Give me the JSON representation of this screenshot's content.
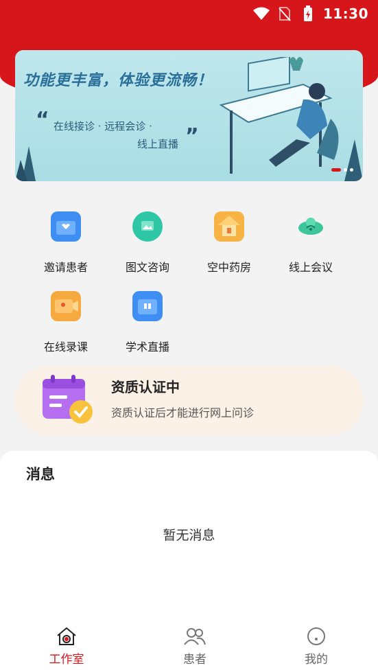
{
  "status": {
    "time": "11:30"
  },
  "banner": {
    "title": "功能更丰富，体验更流畅！",
    "line1": "在线接诊 · 远程会诊 ·",
    "line2": "线上直播"
  },
  "grid": [
    {
      "label": "邀请患者",
      "icon": "invite-patient-icon",
      "color": "#3f8ef4"
    },
    {
      "label": "图文咨询",
      "icon": "image-consult-icon",
      "color": "#2fc6a6"
    },
    {
      "label": "空中药房",
      "icon": "pharmacy-icon",
      "color": "#f7b445"
    },
    {
      "label": "线上会议",
      "icon": "meeting-icon",
      "color": "#3cc69a"
    },
    {
      "label": "在线录课",
      "icon": "record-course-icon",
      "color": "#f5a93f"
    },
    {
      "label": "学术直播",
      "icon": "live-tv-icon",
      "color": "#3f8ef4"
    }
  ],
  "certification": {
    "title": "资质认证中",
    "subtitle": "资质认证后才能进行网上问诊"
  },
  "messages": {
    "title": "消息",
    "empty": "暂无消息"
  },
  "tabs": [
    {
      "label": "工作室",
      "icon": "home-icon",
      "active": true
    },
    {
      "label": "患者",
      "icon": "patients-icon",
      "active": false
    },
    {
      "label": "我的",
      "icon": "profile-icon",
      "active": false
    }
  ],
  "colors": {
    "brand": "#d7161b",
    "cert_bg": "#fcf1e6"
  }
}
